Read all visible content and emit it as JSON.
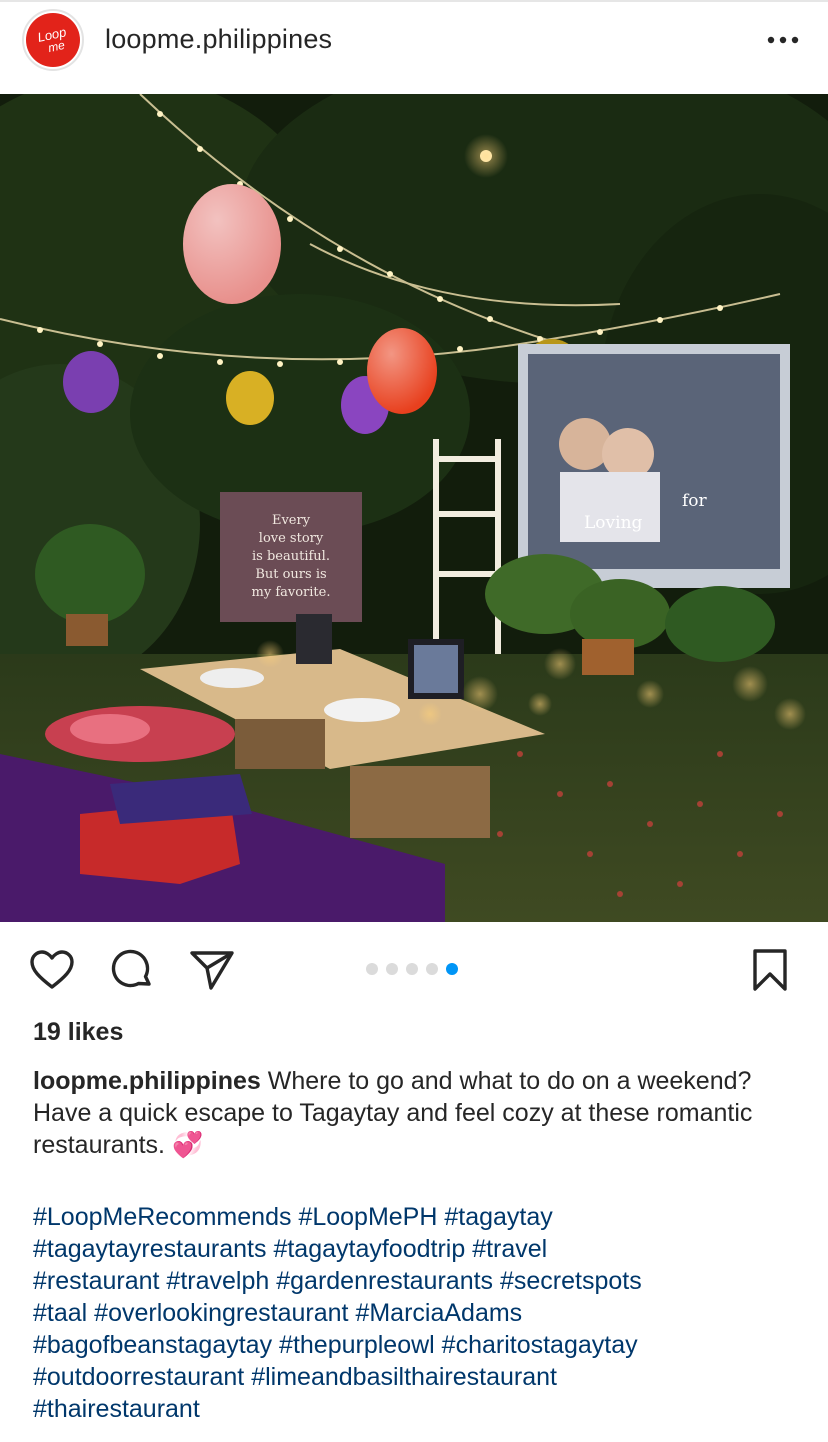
{
  "post": {
    "username": "loopme.philippines",
    "avatar_text": "Loop me",
    "more_icon": "more-horizontal-icon",
    "likes": "19 likes",
    "caption_user": "loopme.philippines",
    "caption_text": "Where to go and what to do on a weekend? Have a quick escape to Tagaytay and feel cozy at these romantic restaurants.",
    "caption_emoji": "💞",
    "hashtag_lines": [
      [
        "#LoopMeRecommends",
        "#LoopMePH",
        "#tagaytay"
      ],
      [
        "#tagaytayrestaurants",
        "#tagaytayfoodtrip",
        "#travel"
      ],
      [
        "#restaurant",
        "#travelph",
        "#gardenrestaurants",
        "#secretspots"
      ],
      [
        "#taal",
        "#overlookingrestaurant",
        "#MarciaAdams"
      ],
      [
        "#bagofbeanstagaytay",
        "#thepurpleowl",
        "#charitostagaytay"
      ],
      [
        "#outdoorrestaurant",
        "#limeandbasilthairestaurant"
      ],
      [
        "#thairestaurant"
      ]
    ]
  },
  "photo": {
    "sign_text": [
      "Every",
      "love story",
      "is beautiful.",
      "But ours is",
      "my favorite."
    ],
    "screen_text": [
      "for",
      "Loving"
    ]
  },
  "carousel": {
    "count": 5,
    "active_index": 4
  },
  "colors": {
    "accent": "#0095f6",
    "hashtag": "#00376b",
    "brand_red": "#e2231a"
  },
  "icons": [
    "heart-icon",
    "comment-icon",
    "share-icon",
    "bookmark-icon"
  ]
}
